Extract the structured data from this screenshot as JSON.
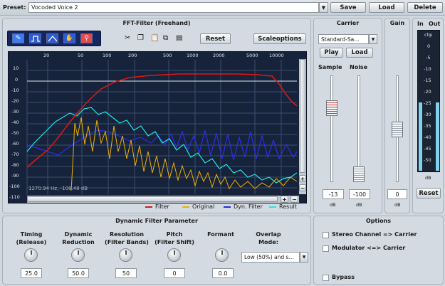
{
  "top": {
    "preset_label": "Preset:",
    "preset_value": "Vocoded Voice 2",
    "save": "Save",
    "load": "Load",
    "delete": "Delete"
  },
  "fft": {
    "title": "FFT-Filter (Freehand)",
    "reset": "Reset",
    "scaleoptions": "Scaleoptions",
    "status": "1270.94 Hz, -108.48 dB",
    "x_ticks": [
      "20",
      "50",
      "100",
      "200",
      "500",
      "1000",
      "2000",
      "5000",
      "10000"
    ],
    "y_ticks": [
      "10",
      "0",
      "-10",
      "-20",
      "-30",
      "-40",
      "-50",
      "-60",
      "-70",
      "-80",
      "-90",
      "-100",
      "-110"
    ],
    "legend": [
      {
        "name": "Filter",
        "color": "#e01818"
      },
      {
        "name": "Original",
        "color": "#f0b000"
      },
      {
        "name": "Dyn. Filter",
        "color": "#2a2ae0"
      },
      {
        "name": "Result",
        "color": "#22e8e8"
      }
    ]
  },
  "carrier": {
    "title": "Carrier",
    "select": "Standard-Sa...",
    "play": "Play",
    "load": "Load",
    "sample_label": "Sample",
    "noise_label": "Noise",
    "sample_value": "-13",
    "noise_value": "-100",
    "unit": "dB"
  },
  "gain": {
    "title": "Gain",
    "value": "0",
    "unit": "dB"
  },
  "meter": {
    "in": "In",
    "out": "Out",
    "reset": "Reset",
    "unit": "dB",
    "scale": [
      "clip",
      "0",
      "-5",
      "-10",
      "-15",
      "-20",
      "-25",
      "-30",
      "-35",
      "-40",
      "-45",
      "-50"
    ]
  },
  "dyn": {
    "title": "Dynamic Filter Parameter",
    "params": [
      {
        "l1": "Timing",
        "l2": "(Release)",
        "value": "25.0"
      },
      {
        "l1": "Dynamic",
        "l2": "Reduction",
        "value": "50.0"
      },
      {
        "l1": "Resolution",
        "l2": "(Filter Bands)",
        "value": "50"
      },
      {
        "l1": "Pitch",
        "l2": "(Filter Shift)",
        "value": "0"
      },
      {
        "l1": "Formant",
        "l2": "",
        "value": "0.0"
      }
    ],
    "overlap_l1": "Overlap",
    "overlap_l2": "Mode:",
    "overlap_value": "Low (50%) and s..."
  },
  "options": {
    "title": "Options",
    "stereo": "Stereo Channel => Carrier",
    "modulator": "Modulator <=> Carrier",
    "bypass": "Bypass"
  }
}
